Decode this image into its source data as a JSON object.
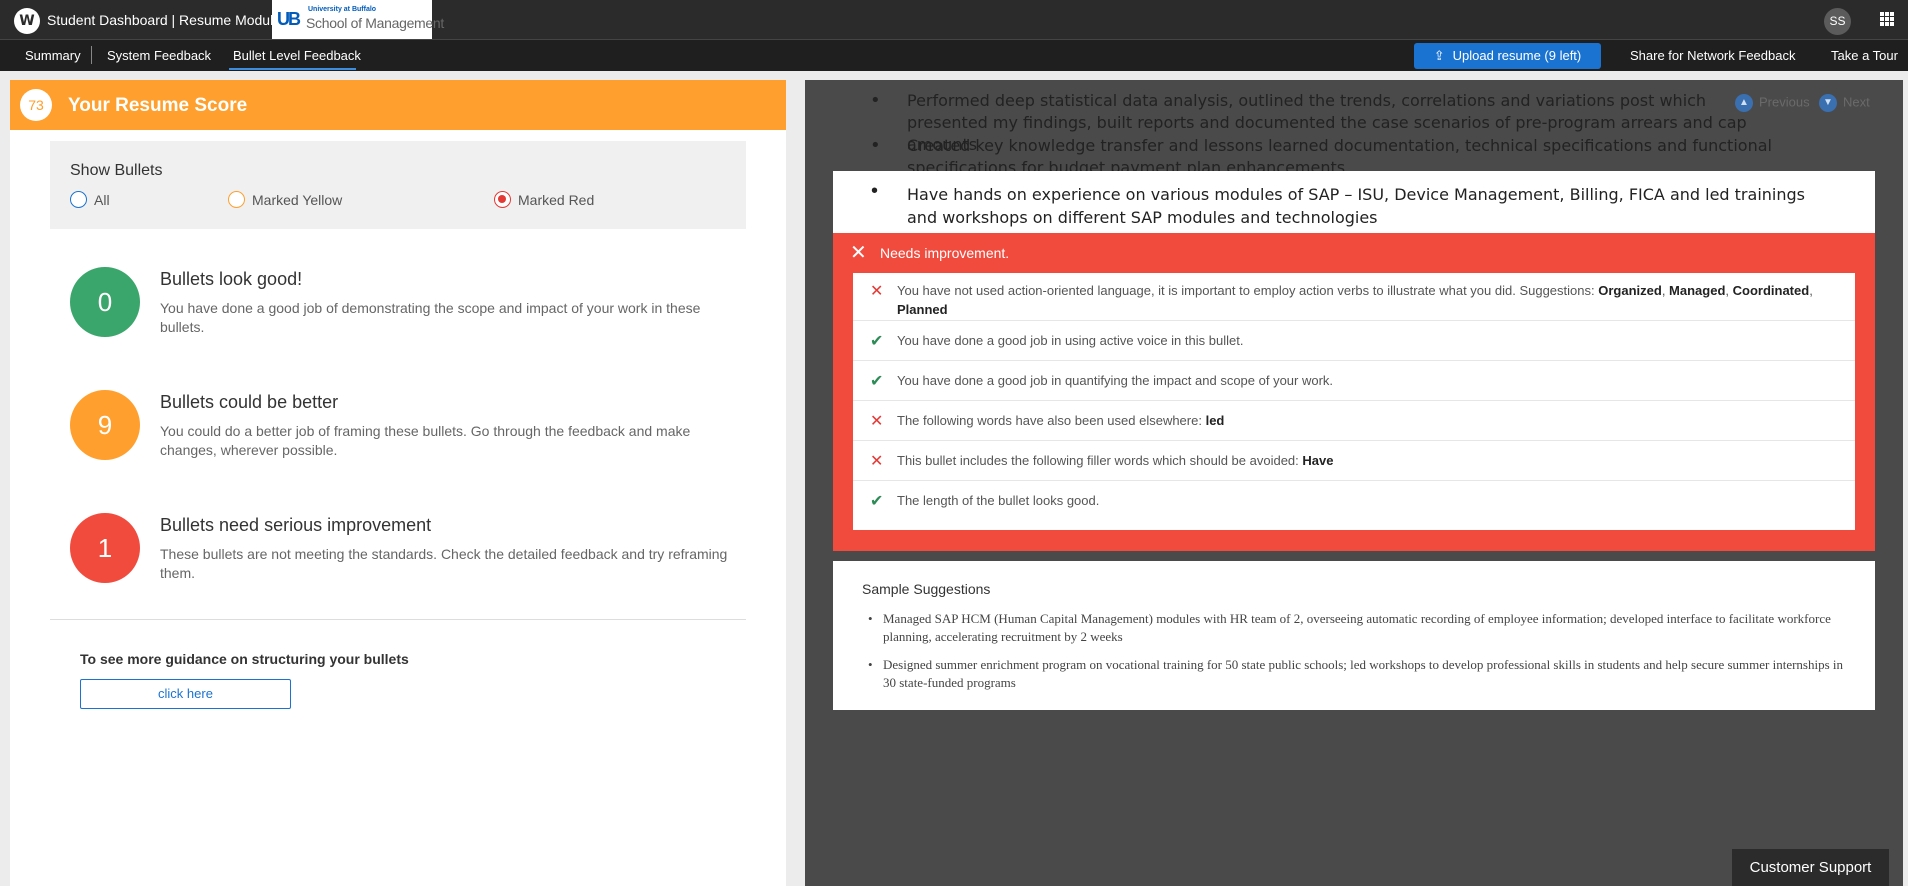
{
  "header": {
    "app_title": "Student Dashboard | Resume Module",
    "logo_initial": "W",
    "partner_logo_line1": "University at Buffalo",
    "partner_logo_line2": "School of Management",
    "avatar_initials": "SS"
  },
  "nav": {
    "tabs": [
      {
        "label": "Summary"
      },
      {
        "label": "System Feedback"
      },
      {
        "label": "Bullet Level Feedback",
        "active": true
      }
    ],
    "upload_label": "Upload resume (9 left)",
    "share_label": "Share for Network Feedback",
    "tour_label": "Take a Tour"
  },
  "score": {
    "value": "73",
    "title": "Your Resume Score"
  },
  "show_bullets": {
    "title": "Show Bullets",
    "options": [
      {
        "label": "All",
        "color": "#1a73d1",
        "selected": false
      },
      {
        "label": "Marked Yellow",
        "color": "#ff9f2d",
        "selected": false
      },
      {
        "label": "Marked Red",
        "color": "#e53935",
        "selected": true
      }
    ]
  },
  "categories": [
    {
      "count": "0",
      "color": "#3aa66b",
      "title": "Bullets look good!",
      "desc": "You have done a good job of demonstrating the scope and impact of your work in these bullets."
    },
    {
      "count": "9",
      "color": "#ff9f2d",
      "title": "Bullets could be better",
      "desc": "You could do a better job of framing these bullets. Go through the feedback and make changes, wherever possible."
    },
    {
      "count": "1",
      "color": "#f14b3e",
      "title": "Bullets need serious improvement",
      "desc": "These bullets are not meeting the standards. Check the detailed feedback and try reframing them."
    }
  ],
  "guidance": {
    "text": "To see more guidance on structuring your bullets",
    "button_label": "click here"
  },
  "resume_bullets": [
    "Performed deep statistical data analysis, outlined the trends, correlations and variations post which presented my findings, built reports and documented the case scenarios of pre-program arrears and cap amounts",
    "Created key knowledge transfer and lessons learned documentation, technical specifications and functional specifications for budget payment plan enhancements"
  ],
  "pager": {
    "previous_label": "Previous",
    "next_label": "Next"
  },
  "focused_bullet": "Have hands on experience on various modules of SAP – ISU, Device Management, Billing, FICA and led trainings and workshops on different SAP modules and technologies",
  "needs_improvement": {
    "title": "Needs improvement.",
    "items": [
      {
        "status": "bad",
        "text": "You have not used action-oriented language, it is important to employ action verbs to illustrate what you did. Suggestions: ",
        "keywords": [
          "Organized",
          "Managed",
          "Coordinated",
          "Planned"
        ]
      },
      {
        "status": "good",
        "text": "You have done a good job in using active voice in this bullet.",
        "keywords": []
      },
      {
        "status": "good",
        "text": "You have done a good job in quantifying the impact and scope of your work.",
        "keywords": []
      },
      {
        "status": "bad",
        "text": "The following words have also been used elsewhere: ",
        "keywords": [
          "led"
        ]
      },
      {
        "status": "bad",
        "text": "This bullet includes the following filler words which should be avoided: ",
        "keywords": [
          "Have"
        ]
      },
      {
        "status": "good",
        "text": "The length of the bullet looks good.",
        "keywords": []
      }
    ]
  },
  "samples": {
    "title": "Sample Suggestions",
    "items": [
      "Managed SAP HCM (Human Capital Management) modules with HR team of 2, overseeing automatic recording of employee information; developed interface to facilitate workforce planning, accelerating recruitment by 2 weeks",
      "Designed summer enrichment program on vocational training for 50 state public schools; led workshops to develop professional skills in students and help secure summer internships in 30 state-funded programs"
    ]
  },
  "support_label": "Customer Support"
}
